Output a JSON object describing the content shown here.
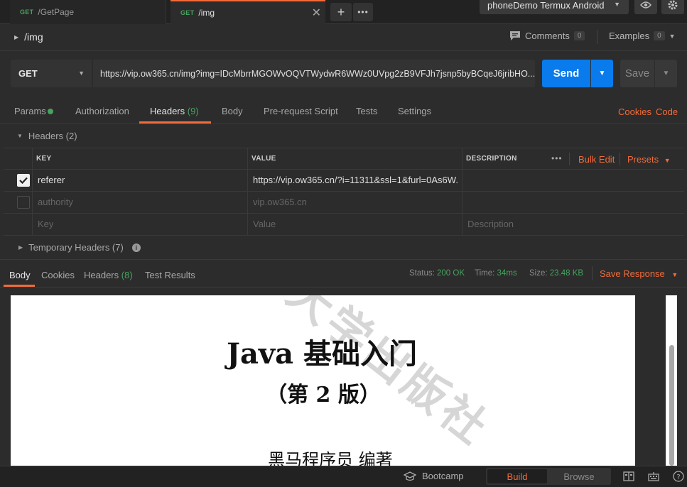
{
  "tabs": [
    {
      "method": "GET",
      "name": "/GetPage"
    },
    {
      "method": "GET",
      "name": "/img"
    }
  ],
  "environment": "phoneDemo Termux Android",
  "request": {
    "title": "/img",
    "comments_label": "Comments",
    "comments_count": "0",
    "examples_label": "Examples",
    "examples_count": "0",
    "method": "GET",
    "url": "https://vip.ow365.cn/img?img=IDcMbrrMGOWvOQVTWydwR6WWz0UVpg2zB9VFJh7jsnp5byBCqeJ6jribHO...",
    "send_label": "Send",
    "save_label": "Save"
  },
  "request_tabs": {
    "params": "Params",
    "authorization": "Authorization",
    "headers": "Headers",
    "headers_count": "(9)",
    "body": "Body",
    "pre_request": "Pre-request Script",
    "tests": "Tests",
    "settings": "Settings",
    "cookies": "Cookies",
    "code": "Code"
  },
  "headers_section": {
    "toggle_label": "Headers (2)",
    "columns": {
      "key": "KEY",
      "value": "VALUE",
      "description": "DESCRIPTION"
    },
    "bulk_edit": "Bulk Edit",
    "presets": "Presets",
    "rows": [
      {
        "key": "referer",
        "value": "https://vip.ow365.cn/?i=11311&ssl=1&furl=0As6W...",
        "checked": true
      },
      {
        "key": "authority",
        "value": "vip.ow365.cn",
        "checked": false
      }
    ],
    "placeholders": {
      "key": "Key",
      "value": "Value",
      "description": "Description"
    },
    "temporary": "Temporary Headers (7)"
  },
  "response": {
    "tabs": {
      "body": "Body",
      "cookies": "Cookies",
      "headers": "Headers",
      "headers_count": "(8)",
      "test_results": "Test Results"
    },
    "status_label": "Status:",
    "status_value": "200 OK",
    "time_label": "Time:",
    "time_value": "34ms",
    "size_label": "Size:",
    "size_value": "23.48 KB",
    "save_response": "Save Response",
    "preview": {
      "title": "Java 基础入门",
      "edition": "（第 2 版）",
      "author": "黑马程序员   编著",
      "watermark": "大学出版社"
    }
  },
  "footer": {
    "bootcamp": "Bootcamp",
    "build": "Build",
    "browse": "Browse"
  },
  "colors": {
    "accent": "#f26b3a",
    "send": "#097bed",
    "green": "#46a35e"
  }
}
